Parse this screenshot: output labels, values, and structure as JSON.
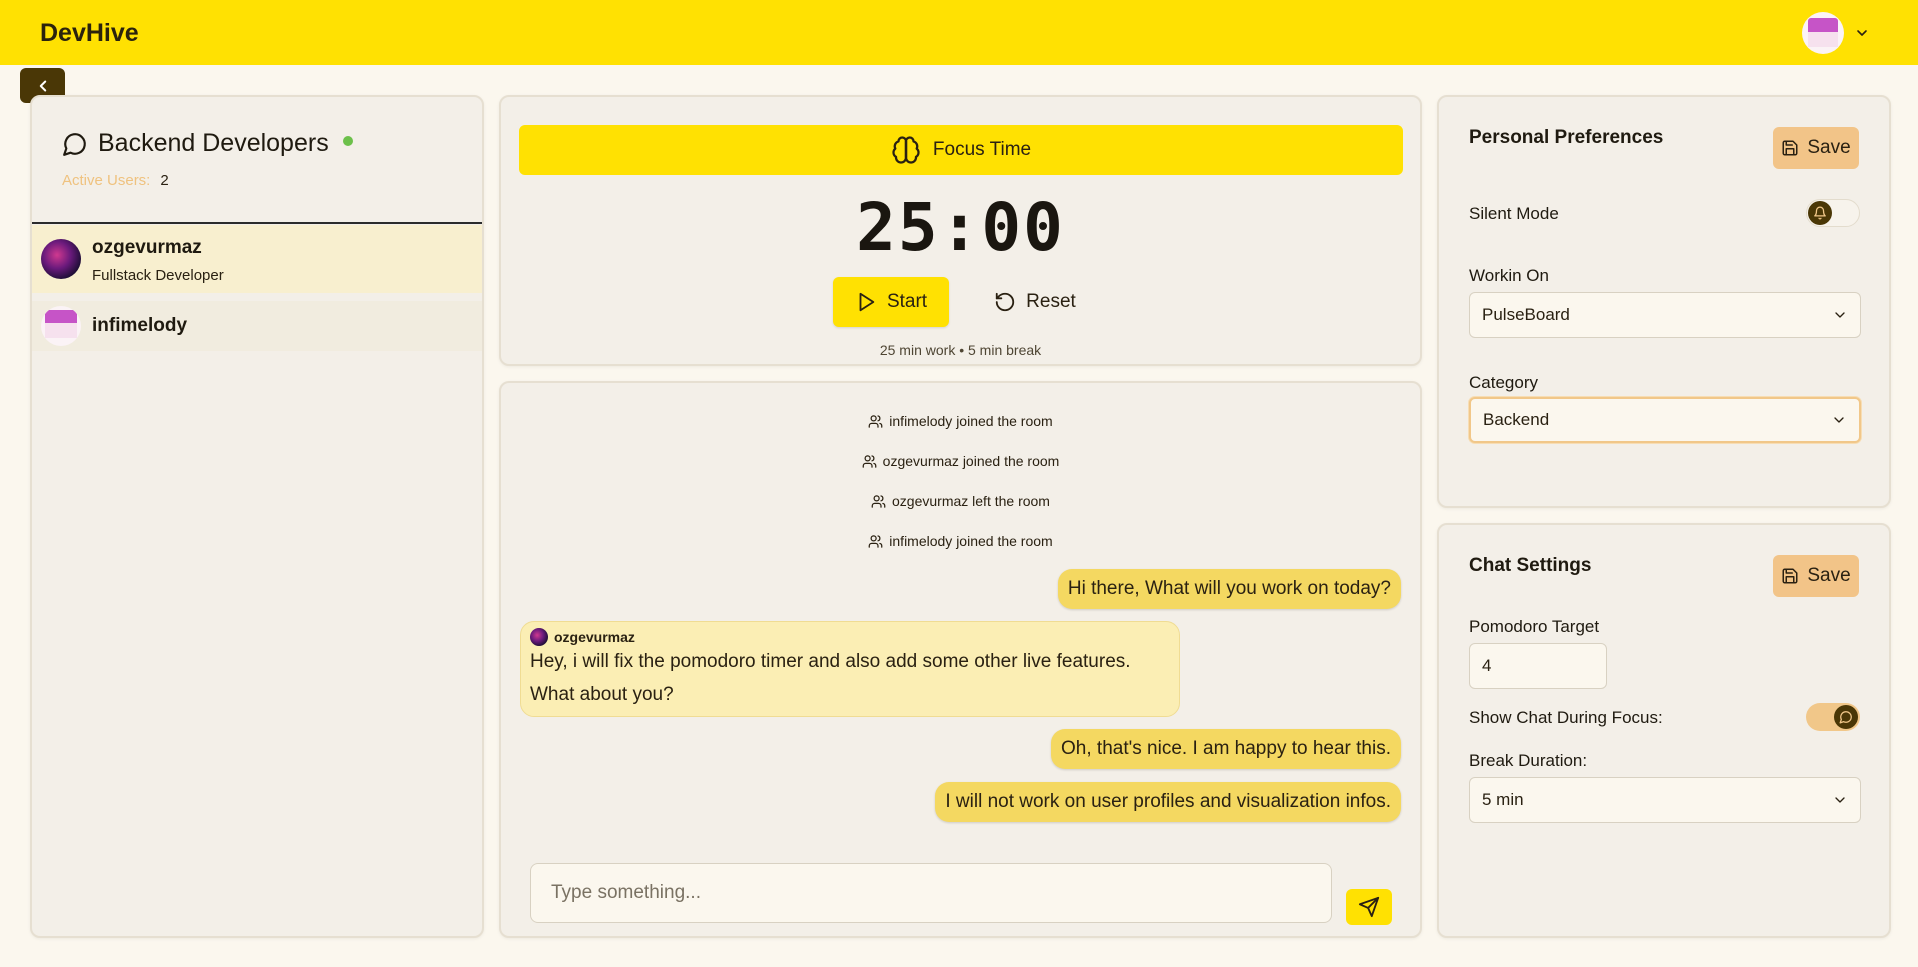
{
  "app": {
    "brand": "DevHive"
  },
  "room": {
    "name": "Backend Developers",
    "active_users_label": "Active Users:",
    "active_users_count": "2",
    "users": [
      {
        "name": "ozgevurmaz",
        "role": "Fullstack Developer"
      },
      {
        "name": "infimelody"
      }
    ]
  },
  "timer": {
    "mode_label": "Focus Time",
    "time": "25:00",
    "start_label": "Start",
    "reset_label": "Reset",
    "note": "25 min work • 5 min break"
  },
  "chat": {
    "system_messages": [
      "infimelody joined the room",
      "ozgevurmaz joined the room",
      "ozgevurmaz left the room",
      "infimelody joined the room"
    ],
    "messages": [
      {
        "from": "me",
        "text": "Hi there, What will you work on today?"
      },
      {
        "from": "ozgevurmaz",
        "lines": [
          "Hey, i will fix the pomodoro timer and also add some other live features.",
          "What about you?"
        ]
      },
      {
        "from": "me",
        "text": "Oh, that's nice. I am happy to hear this."
      },
      {
        "from": "me",
        "text": "I will not work on user profiles and visualization infos."
      }
    ],
    "input_placeholder": "Type something..."
  },
  "preferences": {
    "title": "Personal Preferences",
    "save_label": "Save",
    "silent_mode_label": "Silent Mode",
    "silent_mode_on": false,
    "working_on_label": "Workin On",
    "working_on_value": "PulseBoard",
    "category_label": "Category",
    "category_value": "Backend"
  },
  "chat_settings": {
    "title": "Chat Settings",
    "save_label": "Save",
    "pomodoro_target_label": "Pomodoro Target",
    "pomodoro_target_value": "4",
    "show_chat_label": "Show Chat During Focus:",
    "show_chat_on": true,
    "break_duration_label": "Break Duration:",
    "break_duration_value": "5 min"
  },
  "colors": {
    "brand_yellow": "#ffe102",
    "page_bg": "#fbf7ee",
    "panel_bg": "#f3efe8",
    "accent_orange": "#f2c488",
    "dark_brown": "#4a3706",
    "my_bubble": "#f4d861",
    "other_bubble": "#fbeeb4",
    "online_green": "#6cc04a"
  },
  "icons": [
    "chevron-down-icon",
    "chevron-left-icon",
    "chat-bubble-icon",
    "brain-icon",
    "play-icon",
    "reset-icon",
    "users-icon",
    "send-icon",
    "save-icon",
    "bell-icon"
  ]
}
